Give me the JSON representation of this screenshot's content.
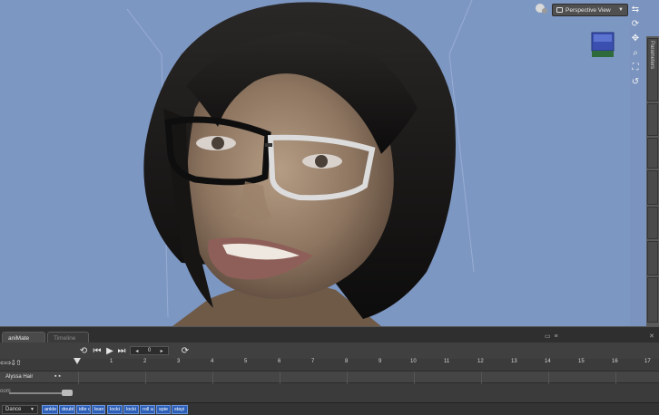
{
  "viewport": {
    "view_name": "Perspective View",
    "background_color": "#7d97c3",
    "tools": [
      "pan-icon",
      "orbit-icon",
      "move-icon",
      "zoom-icon",
      "frame-icon",
      "reset-icon"
    ]
  },
  "side_panel": {
    "tabs": [
      "Parameters",
      "",
      "",
      "",
      "",
      "",
      ""
    ]
  },
  "pane": {
    "tabs": [
      {
        "label": "aniMate Lite",
        "active": true
      },
      {
        "label": "Timeline",
        "active": false
      }
    ],
    "frame_value": "0",
    "ruler_ticks": [
      "1",
      "2",
      "3",
      "4",
      "5",
      "6",
      "7",
      "8",
      "9",
      "10",
      "11",
      "12",
      "13",
      "14",
      "15",
      "16",
      "17"
    ],
    "track": {
      "name": "Alyssa Hair"
    },
    "zoom_label": "oom",
    "category": "Dance",
    "aniblocks": [
      "ankle",
      "doubl",
      "idle c",
      "lean",
      "locki",
      "locki",
      "roll a",
      "spie",
      "stayi"
    ],
    "accent_color": "#2c5fb8"
  }
}
